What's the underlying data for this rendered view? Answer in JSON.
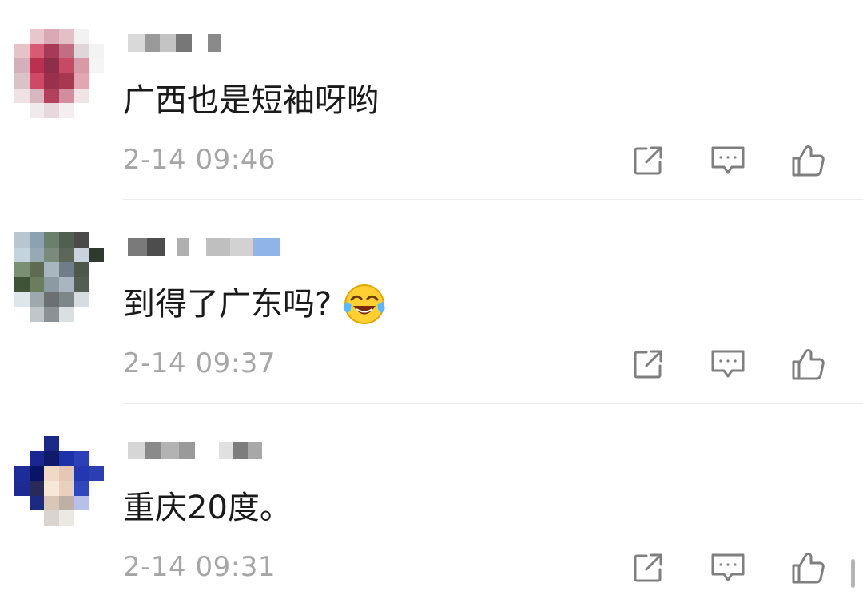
{
  "comments": [
    {
      "text": "广西也是短袖呀哟",
      "time": "2-14 09:46",
      "has_emoji": false,
      "avatar_colors": [
        "#ffffff",
        "#e9c5cc",
        "#d9aab6",
        "#e3c0c8",
        "#f2f2f2",
        "#ffffff",
        "#e6c2c9",
        "#d85a73",
        "#a73a56",
        "#c46c82",
        "#e0d6d9",
        "#f3f3f3",
        "#d3b0bb",
        "#b9314f",
        "#8e2e4a",
        "#c74964",
        "#d99aa8",
        "#f5f5f5",
        "#d9c2c8",
        "#cf4966",
        "#9b304c",
        "#a8384f",
        "#e2a6b3",
        "#ffffff",
        "#efe1e4",
        "#d7b6bf",
        "#b23f5b",
        "#d48d9e",
        "#f0e4e7",
        "#ffffff",
        "#ffffff",
        "#f0eaec",
        "#e6d8dc",
        "#f4eef0",
        "#ffffff",
        "#ffffff"
      ],
      "username_blocks": [
        {
          "w": 22,
          "c": "#d9d9d9",
          "gap": 0
        },
        {
          "w": 18,
          "c": "#9a9a9a",
          "gap": 0
        },
        {
          "w": 20,
          "c": "#c4c4c4",
          "gap": 0
        },
        {
          "w": 20,
          "c": "#777777",
          "gap": 20
        },
        {
          "w": 16,
          "c": "#8a8a8a",
          "gap": 0
        }
      ]
    },
    {
      "text": "到得了广东吗?",
      "time": "2-14 09:37",
      "has_emoji": true,
      "avatar_colors": [
        "#b9c6cf",
        "#8da1b0",
        "#6b7f6a",
        "#505f50",
        "#4a4a4a",
        "#ffffff",
        "#c4d3dd",
        "#97a9b5",
        "#7a8a7c",
        "#5b6758",
        "#c9d3dd",
        "#2f3a2f",
        "#7b8f73",
        "#5e6b52",
        "#a8b6c0",
        "#6e7d88",
        "#4d584a",
        "#ffffff",
        "#3f5436",
        "#6b7c5f",
        "#8c9aa4",
        "#a9b6c1",
        "#525d54",
        "#ffffff",
        "#dfe6eb",
        "#9ea9ae",
        "#6b7073",
        "#7d8689",
        "#d6dce0",
        "#ffffff",
        "#ffffff",
        "#c1c6c9",
        "#8b9194",
        "#dadfe2",
        "#ffffff",
        "#ffffff"
      ],
      "username_blocks": [
        {
          "w": 24,
          "c": "#7a7a7a",
          "gap": 0
        },
        {
          "w": 22,
          "c": "#4d4d4d",
          "gap": 16
        },
        {
          "w": 14,
          "c": "#b0b0b0",
          "gap": 22
        },
        {
          "w": 30,
          "c": "#bfbfbf",
          "gap": 0
        },
        {
          "w": 28,
          "c": "#d2d2d2",
          "gap": 0
        },
        {
          "w": 34,
          "c": "#8fb4e6",
          "gap": 0
        }
      ]
    },
    {
      "text": "重庆20度。",
      "time": "2-14 09:31",
      "has_emoji": false,
      "avatar_colors": [
        "#ffffff",
        "#ffffff",
        "#1b2a86",
        "#ffffff",
        "#ffffff",
        "#ffffff",
        "#ffffff",
        "#1a2793",
        "#0f1a6b",
        "#1d31a9",
        "#2c3fb8",
        "#ffffff",
        "#1c2c98",
        "#0a1466",
        "#f0d9c7",
        "#e6c7b3",
        "#2237b0",
        "#2b3fb3",
        "#1d2a8f",
        "#2a2a5a",
        "#f7e7d8",
        "#e8d0bd",
        "#3046bd",
        "#ffffff",
        "#ffffff",
        "#1c2a82",
        "#d9c6b7",
        "#bfb0a6",
        "#b7c0e8",
        "#ffffff",
        "#ffffff",
        "#ffffff",
        "#d9d4cf",
        "#ece8e4",
        "#ffffff",
        "#ffffff"
      ],
      "username_blocks": [
        {
          "w": 22,
          "c": "#d6d6d6",
          "gap": 0
        },
        {
          "w": 20,
          "c": "#8a8a8a",
          "gap": 0
        },
        {
          "w": 22,
          "c": "#b3b3b3",
          "gap": 0
        },
        {
          "w": 20,
          "c": "#9a9a9a",
          "gap": 30
        },
        {
          "w": 18,
          "c": "#e0e0e0",
          "gap": 0
        },
        {
          "w": 18,
          "c": "#7d7d7d",
          "gap": 0
        },
        {
          "w": 18,
          "c": "#a8a8a8",
          "gap": 0
        }
      ]
    }
  ],
  "icons": {
    "share": "share-icon",
    "reply": "comment-icon",
    "like": "thumbs-up-icon",
    "emoji": "tears-of-joy-emoji"
  },
  "colors": {
    "text": "#1a1a1a",
    "meta": "#a6a6a6",
    "icon": "#7f7f7f",
    "divider": "#ececec"
  }
}
